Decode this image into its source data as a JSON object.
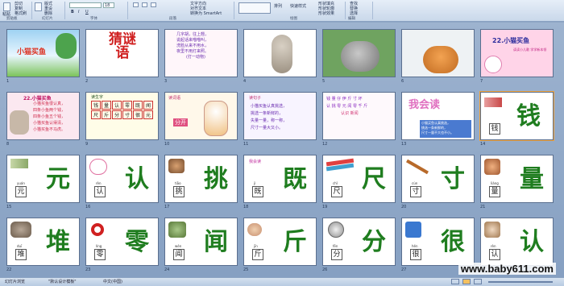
{
  "ribbon": {
    "paste_label": "粘贴",
    "clipboard_items": [
      "剪切",
      "复制",
      "格式刷"
    ],
    "new_slide_label": "新建\n幻灯片",
    "layout_label": "版式",
    "reset_label": "重设",
    "delete_label": "删除",
    "font_size": "18",
    "text_direction": "文字方向",
    "align_text": "对齐文本",
    "convert_smartart": "转换为 SmartArt",
    "arrange_label": "排列",
    "quick_styles": "快速样式",
    "shape_fill": "形状填充",
    "shape_outline": "形状轮廓",
    "shape_effects": "形状效果",
    "find_label": "查找",
    "replace_label": "替换",
    "select_label": "选择",
    "groups": [
      "剪贴板",
      "幻灯片",
      "字体",
      "段落",
      "绘图",
      "编辑"
    ]
  },
  "slides": {
    "row1": [
      {
        "n": "1",
        "title": "小猫买鱼"
      },
      {
        "n": "2",
        "title": "猜谜语"
      },
      {
        "n": "3",
        "lines": [
          "几字胡，往上翘，",
          "说起话来喵喵叫，",
          "洗脸从来不用水，",
          "夜里不用灯来照。",
          "(打一动物)"
        ]
      },
      {
        "n": "4"
      },
      {
        "n": "5"
      },
      {
        "n": "6"
      },
      {
        "n": "7",
        "title": "22.小猫买鱼",
        "subtitle": "读读小儿歌 学学新本领"
      }
    ],
    "row2": [
      {
        "n": "8",
        "title": "22.小猫买鱼",
        "lines": [
          "小猫买鱼很认真，",
          "四条小鱼两个钱，",
          "四条小鱼五个钱，",
          "小猫买鱼认得清，",
          "小猫买鱼不马虎。"
        ]
      },
      {
        "n": "9",
        "title": "读生字",
        "cells": [
          "钱",
          "量",
          "认",
          "零",
          "既",
          "闻",
          "尺",
          "斤",
          "分",
          "寸",
          "很",
          "元"
        ]
      },
      {
        "n": "10",
        "title": "读词语",
        "words": [
          "分开"
        ]
      },
      {
        "n": "11",
        "title": "读句子",
        "lines": [
          "小猫买鱼认真挑选，",
          "挑选一条新鲜的，",
          "失量一量，称一称，",
          "尺寸一量大又小。"
        ]
      },
      {
        "n": "12",
        "lines": [
          "钱 量 仔 伊 斤 寸 坏",
          "认 挑 零 元 闻 零 千 斤",
          "认识 新闻"
        ]
      },
      {
        "n": "13",
        "title": "我会读",
        "lines": [
          "小猫买鱼认真挑选，",
          "挑选一条新鲜的，",
          "尺寸一量不大也不小。"
        ]
      },
      {
        "n": "14",
        "char": "钱",
        "box": "钱"
      }
    ],
    "row3": [
      {
        "n": "15",
        "char": "元",
        "pinyin": "yuán",
        "box": "元"
      },
      {
        "n": "16",
        "char": "认",
        "pinyin": "rèn",
        "box": "认"
      },
      {
        "n": "17",
        "char": "挑",
        "pinyin": "tiāo",
        "box": "挑"
      },
      {
        "n": "18",
        "char": "既",
        "pinyin": "jì",
        "box": "既",
        "tag": "我会读"
      },
      {
        "n": "19",
        "char": "尺",
        "pinyin": "chǐ",
        "box": "尺"
      },
      {
        "n": "20",
        "char": "寸",
        "pinyin": "cùn",
        "box": "寸"
      },
      {
        "n": "21",
        "char": "量",
        "pinyin": "liáng",
        "box": "量"
      }
    ],
    "row4": [
      {
        "n": "22",
        "char": "堆",
        "pinyin": "duī",
        "box": "堆"
      },
      {
        "n": "23",
        "char": "零",
        "pinyin": "líng",
        "box": "零"
      },
      {
        "n": "24",
        "char": "闻",
        "pinyin": "wén",
        "box": "闻"
      },
      {
        "n": "25",
        "char": "斤",
        "pinyin": "jīn",
        "box": "斤"
      },
      {
        "n": "26",
        "char": "分",
        "pinyin": "fēn",
        "box": "分"
      },
      {
        "n": "27",
        "char": "很",
        "pinyin": "hěn",
        "box": "很"
      },
      {
        "n": "28",
        "char": "认",
        "pinyin": "rèn",
        "box": "认"
      }
    ]
  },
  "watermark": "www.baby611.com",
  "status": {
    "slide_sorter": "幻灯片浏览",
    "theme": "\"默认设计模板\"",
    "language": "中文(中国)"
  }
}
